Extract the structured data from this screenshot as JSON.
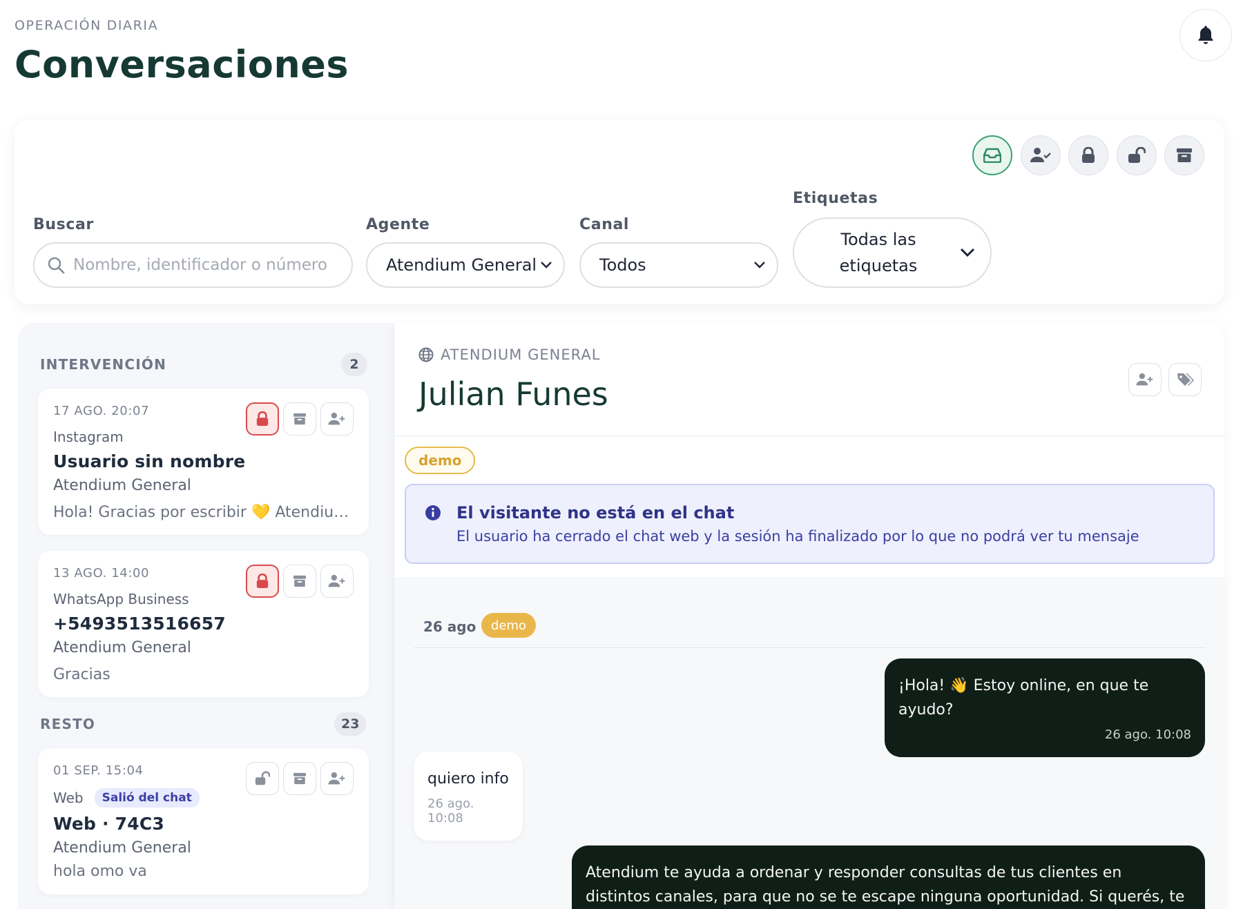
{
  "header": {
    "eyebrow": "OPERACIÓN DIARIA",
    "title": "Conversaciones"
  },
  "filters": {
    "search_label": "Buscar",
    "search_placeholder": "Nombre, identificador o número",
    "agent_label": "Agente",
    "agent_value": "Atendium General",
    "channel_label": "Canal",
    "channel_value": "Todos",
    "tags_label": "Etiquetas",
    "tags_value_line1": "Todas las",
    "tags_value_line2": "etiquetas"
  },
  "sections": {
    "intervention_label": "INTERVENCIÓN",
    "intervention_count": "2",
    "rest_label": "RESTO",
    "rest_count": "23"
  },
  "conversations": [
    {
      "time": "17 AGO. 20:07",
      "channel": "Instagram",
      "name": "Usuario sin nombre",
      "agent": "Atendium General",
      "preview": "Hola! Gracias por escribir 💛 Atendium n..."
    },
    {
      "time": "13 AGO. 14:00",
      "channel": "WhatsApp Business",
      "name": "+5493513516657",
      "agent": "Atendium General",
      "preview": "Gracias"
    },
    {
      "time": "01 SEP. 15:04",
      "channel": "Web",
      "badge": "Salió del chat",
      "name": "Web · 74C3",
      "agent": "Atendium General",
      "preview": "hola omo va"
    }
  ],
  "chat": {
    "channel": "ATENDIUM GENERAL",
    "contact_name": "Julian Funes",
    "tag": "demo",
    "notice_title": "El visitante no está en el chat",
    "notice_body": "El usuario ha cerrado el chat web y la sesión ha finalizado por lo que no podrá ver tu mensaje",
    "day_label": "26 ago",
    "day_tag": "demo",
    "messages": [
      {
        "text": "¡Hola! 👋 Estoy online, en que te ayudo?",
        "time": "26 ago. 10:08"
      },
      {
        "text": "quiero info",
        "time": "26 ago. 10:08"
      },
      {
        "text": "Atendium te ayuda a ordenar y responder consultas de tus clientes en distintos canales, para que no se te escape ninguna oportunidad. Si querés, te cuento"
      }
    ]
  },
  "colors": {
    "brand_dark": "#163a33",
    "active_green": "#3aa172",
    "danger_red": "#d84a4a",
    "tag_yellow": "#e9b749",
    "info_indigo": "#3a3ea0",
    "bubble_dark": "#0f1f17"
  },
  "icons": {
    "bell": "bell-icon",
    "inbox": "inbox-icon",
    "user_check": "user-check-icon",
    "lock": "lock-icon",
    "unlock": "unlock-icon",
    "archive": "archive-icon",
    "user_plus": "user-plus-icon",
    "tags": "tags-icon",
    "globe": "globe-icon",
    "info": "info-icon",
    "search": "search-icon",
    "chevron": "chevron-down-icon"
  }
}
